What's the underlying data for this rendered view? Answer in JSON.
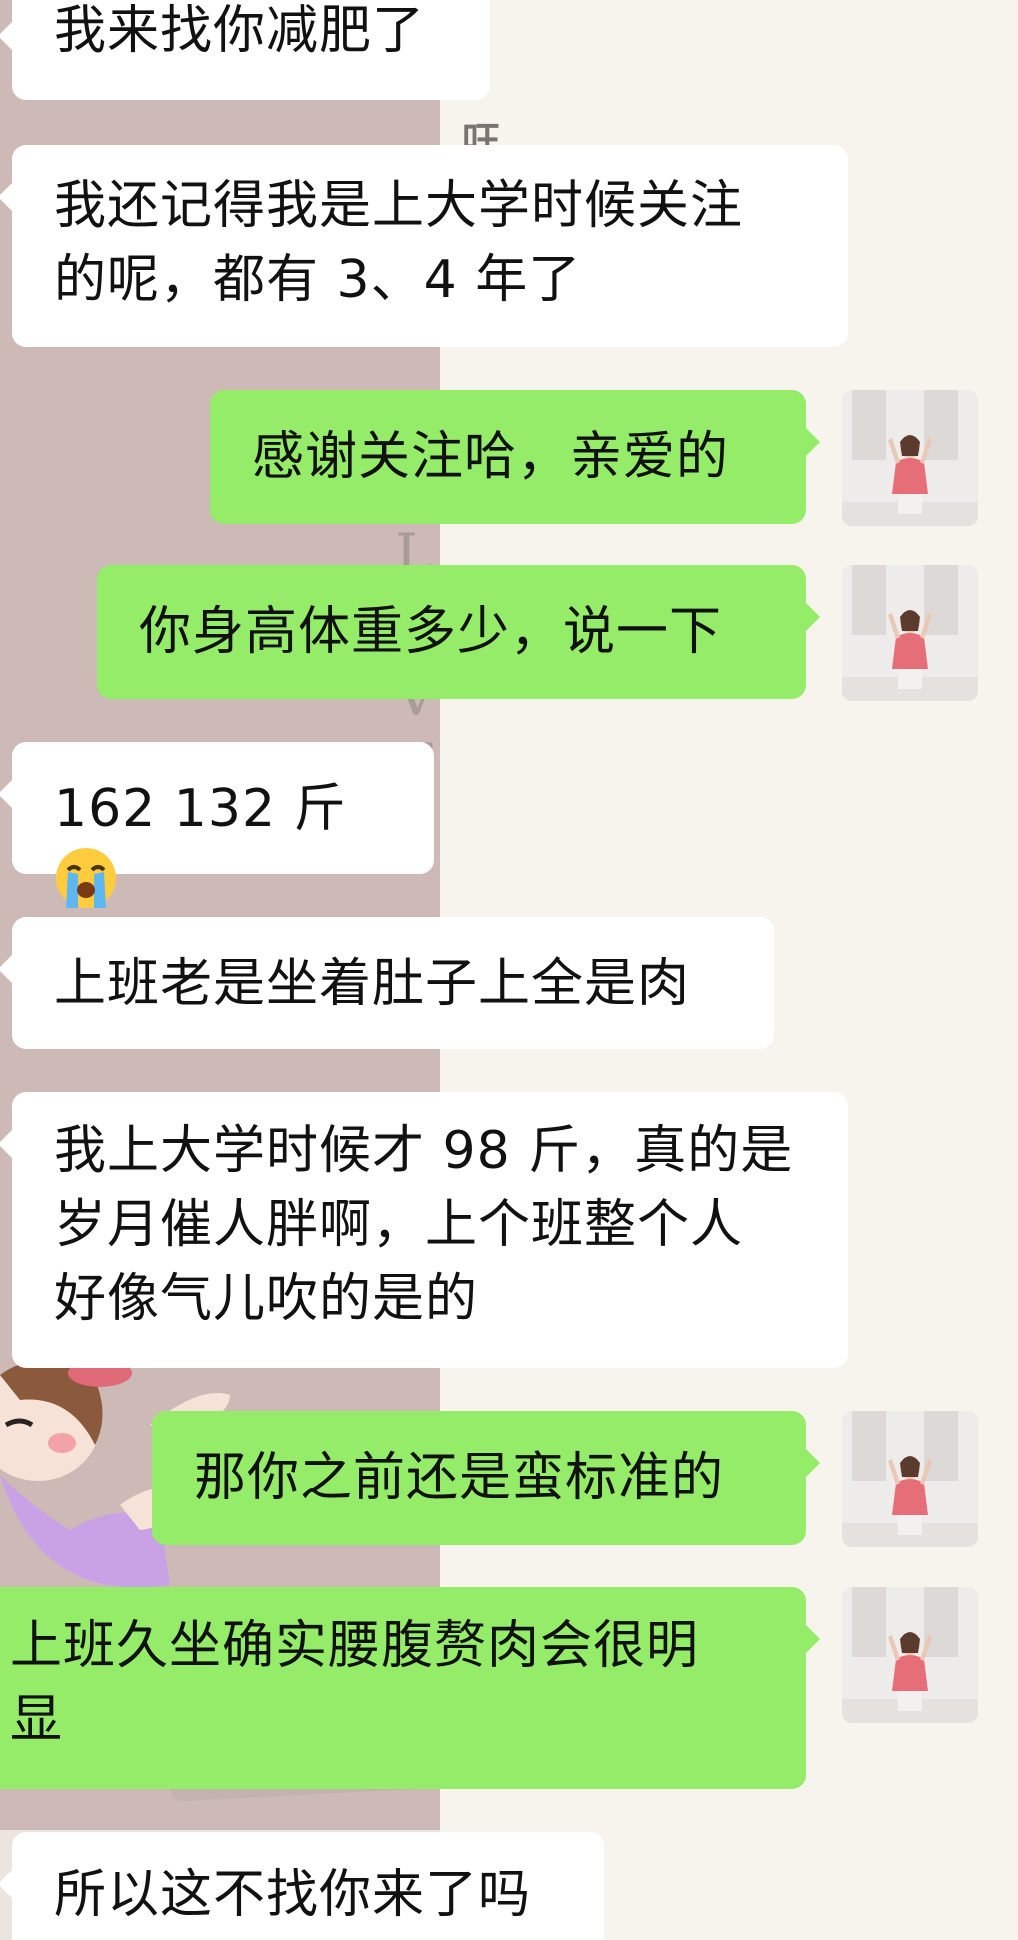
{
  "messages": [
    {
      "side": "in",
      "text": "我来找你减肥了"
    },
    {
      "side": "in",
      "line1": "我还记得我是上大学时候关注",
      "line2": "的呢，都有 3、4 年了"
    },
    {
      "side": "out",
      "text": "感谢关注哈，亲爱的"
    },
    {
      "side": "out",
      "text": "你身高体重多少，说一下"
    },
    {
      "side": "in",
      "text": "162 132 斤",
      "emoji": "loudly-crying-face"
    },
    {
      "side": "in",
      "text": "上班老是坐着肚子上全是肉"
    },
    {
      "side": "in",
      "line1": "我上大学时候才 98 斤，真的是",
      "line2": "岁月催人胖啊，上个班整个人",
      "line3": "好像气儿吹的是的"
    },
    {
      "side": "out",
      "text": "那你之前还是蛮标准的"
    },
    {
      "side": "out",
      "line1": "上班久坐确实腰腹赘肉会很明",
      "line2": "显"
    },
    {
      "side": "in",
      "text": "所以这不找你来了吗"
    }
  ],
  "colors": {
    "incoming_bubble": "#ffffff",
    "outgoing_bubble": "#95ec69",
    "wallpaper_left": "#cdbab6",
    "wallpaper_right": "#f7f4ee"
  },
  "avatar": {
    "icon": "profile-photo-woman-pink-top"
  }
}
